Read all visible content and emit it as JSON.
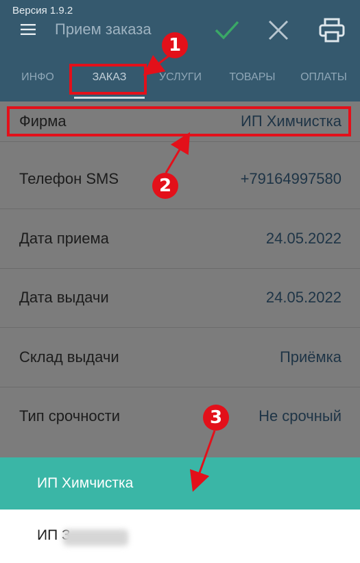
{
  "header": {
    "version": "Версия 1.9.2",
    "title": "Прием заказа",
    "icons": [
      "menu-icon",
      "check-icon",
      "close-icon",
      "print-icon"
    ]
  },
  "tabs": [
    {
      "label": "ИНФО"
    },
    {
      "label": "ЗАКАЗ"
    },
    {
      "label": "УСЛУГИ"
    },
    {
      "label": "ТОВАРЫ"
    },
    {
      "label": "ОПЛАТЫ"
    }
  ],
  "rows": [
    {
      "label": "Фирма",
      "value": "ИП Химчистка"
    },
    {
      "label": "Телефон SMS",
      "value": "+79164997580"
    },
    {
      "label": "Дата приема",
      "value": "24.05.2022"
    },
    {
      "label": "Дата выдачи",
      "value": "24.05.2022"
    },
    {
      "label": "Склад выдачи",
      "value": "Приёмка"
    },
    {
      "label": "Тип срочности",
      "value": "Не срочный"
    }
  ],
  "sheet": {
    "options": [
      "ИП Химчистка",
      "ИП З"
    ]
  },
  "annotations": {
    "badges": [
      "1",
      "2",
      "3"
    ]
  },
  "colors": {
    "appbar": "#35596e",
    "accent_selected": "#3ab6a6",
    "annotation_red": "#e3101a"
  }
}
